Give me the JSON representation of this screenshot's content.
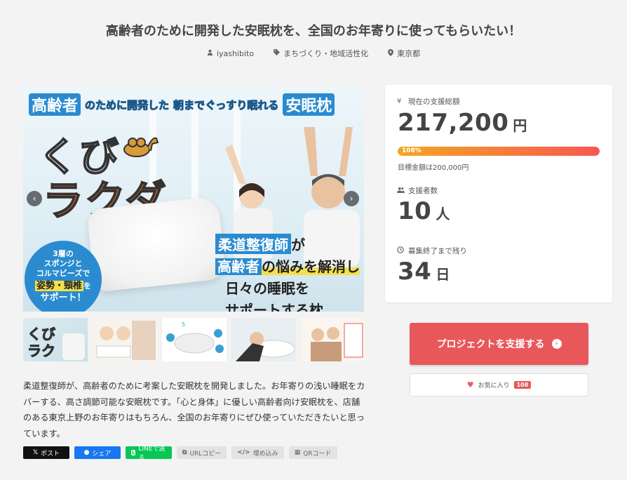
{
  "project": {
    "title": "高齢者のために開発した安眠枕を、全国のお年寄りに使ってもらいたい！",
    "owner": "iyashibito",
    "category": "まちづくり・地域活性化",
    "location": "東京都"
  },
  "hero": {
    "banner_a": "高齢者",
    "banner_b": "のために開発した",
    "banner_c": "朝までぐっすり眠れる",
    "banner_d": "安眠枕",
    "brand_line1": "くび",
    "brand_line2": "ラクダ",
    "badge_lines": [
      "3層の",
      "スポンジと",
      "コルマビーズで"
    ],
    "badge_highlight": "姿勢・頸椎",
    "badge_suffix": "を",
    "badge_last": "サポート！",
    "claim_1": "柔道整復師",
    "claim_1b": "が",
    "claim_2a": "高齢者",
    "claim_2b": "の悩みを解消し",
    "claim_3": "日々の睡眠を",
    "claim_4": "サポートする枕",
    "prev": "‹",
    "next": "›"
  },
  "thumbnails": [
    {
      "name": "くびラクダ"
    },
    {
      "name": "使用イメージ"
    },
    {
      "name": "5つのポイント"
    },
    {
      "name": "睡眠イメージ"
    },
    {
      "name": "お年寄り"
    }
  ],
  "description": "柔道整復師が、高齢者のために考案した安眠枕を開発しました。お年寄りの浅い睡眠をカバーする、高さ調節可能な安眠枕です。「心と身体」に優しい高齢者向け安眠枕を、店舗のある東京上野のお年寄りはもちろん、全国のお年寄りにぜひ使っていただきたいと思っています。",
  "share": {
    "x": "ポスト",
    "facebook": "シェア",
    "line": "LINEで送る",
    "url": "URLコピー",
    "embed": "埋め込み",
    "qr": "QRコード"
  },
  "stats": {
    "raised_label": "現在の支援総額",
    "raised_value": "217,200",
    "raised_unit": "円",
    "progress_percent_label": "108%",
    "progress_fraction": 1.0,
    "goal_text": "目標金額は200,000円",
    "backers_label": "支援者数",
    "backers_value": "10",
    "backers_unit": "人",
    "days_label": "募集終了まで残り",
    "days_value": "34",
    "days_unit": "日"
  },
  "actions": {
    "support_label": "プロジェクトを支援する",
    "favorite_label": "お気に入り",
    "favorite_count": "108"
  },
  "colors": {
    "accent": "#e8585b",
    "progress_start": "#f5a623",
    "progress_end": "#f7584f",
    "line": "#06c755",
    "facebook": "#1877f2"
  }
}
